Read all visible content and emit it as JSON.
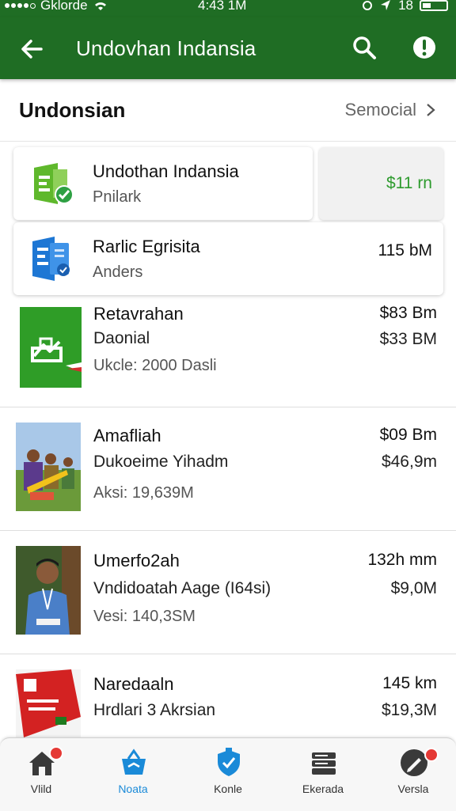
{
  "status_bar": {
    "carrier": "Gklorde",
    "time": "4:43 1M",
    "battery_text": "18"
  },
  "app_bar": {
    "title": "Undovhan Indansia"
  },
  "section": {
    "title": "Undonsian",
    "more_label": "Semocial"
  },
  "cards": [
    {
      "name": "Undothan Indansia",
      "sub": "Pnilark",
      "price": "$11 rn",
      "icon": "spreadsheet-check-icon",
      "accent": "#3aa53a"
    },
    {
      "name": "Rarlic Egrisita",
      "sub": "Anders",
      "price": "115 bM",
      "icon": "document-app-icon",
      "accent": "#1e77d4"
    }
  ],
  "rows": [
    {
      "name": "Retavrahan",
      "sub": "Daonial",
      "meta": "Ukcle: 2000 Dasli",
      "price1": "$83 Bm",
      "price2": "$33 BM",
      "thumb": "green-vote-icon"
    },
    {
      "name": "Amafliah",
      "sub": "Dukoeime Yihadm",
      "meta": "Aksi: 19,639M",
      "price1": "$09 Bm",
      "price2": "$46,9m",
      "thumb": "outdoor-group-photo"
    },
    {
      "name": "Umerfo2ah",
      "sub": "Vndidoatah Aage (I64si)",
      "meta": "Vesi: 140,3SM",
      "price1": "132h mm",
      "price2": "$9,0M",
      "thumb": "man-portrait-photo"
    },
    {
      "name": "Naredaaln",
      "sub": "Hrdlari 3 Akrsian",
      "meta": "",
      "price1": "145 km",
      "price2": "$19,3M",
      "thumb": "red-banner-photo"
    }
  ],
  "bottom_nav": [
    {
      "label": "Vlild",
      "icon": "home-icon",
      "badge": true,
      "active": false
    },
    {
      "label": "Noata",
      "icon": "basket-icon",
      "badge": false,
      "active": true
    },
    {
      "label": "Konle",
      "icon": "shield-icon",
      "badge": false,
      "active": false
    },
    {
      "label": "Ekerada",
      "icon": "stack-icon",
      "badge": false,
      "active": false
    },
    {
      "label": "Versla",
      "icon": "pen-icon",
      "badge": true,
      "active": false
    }
  ]
}
